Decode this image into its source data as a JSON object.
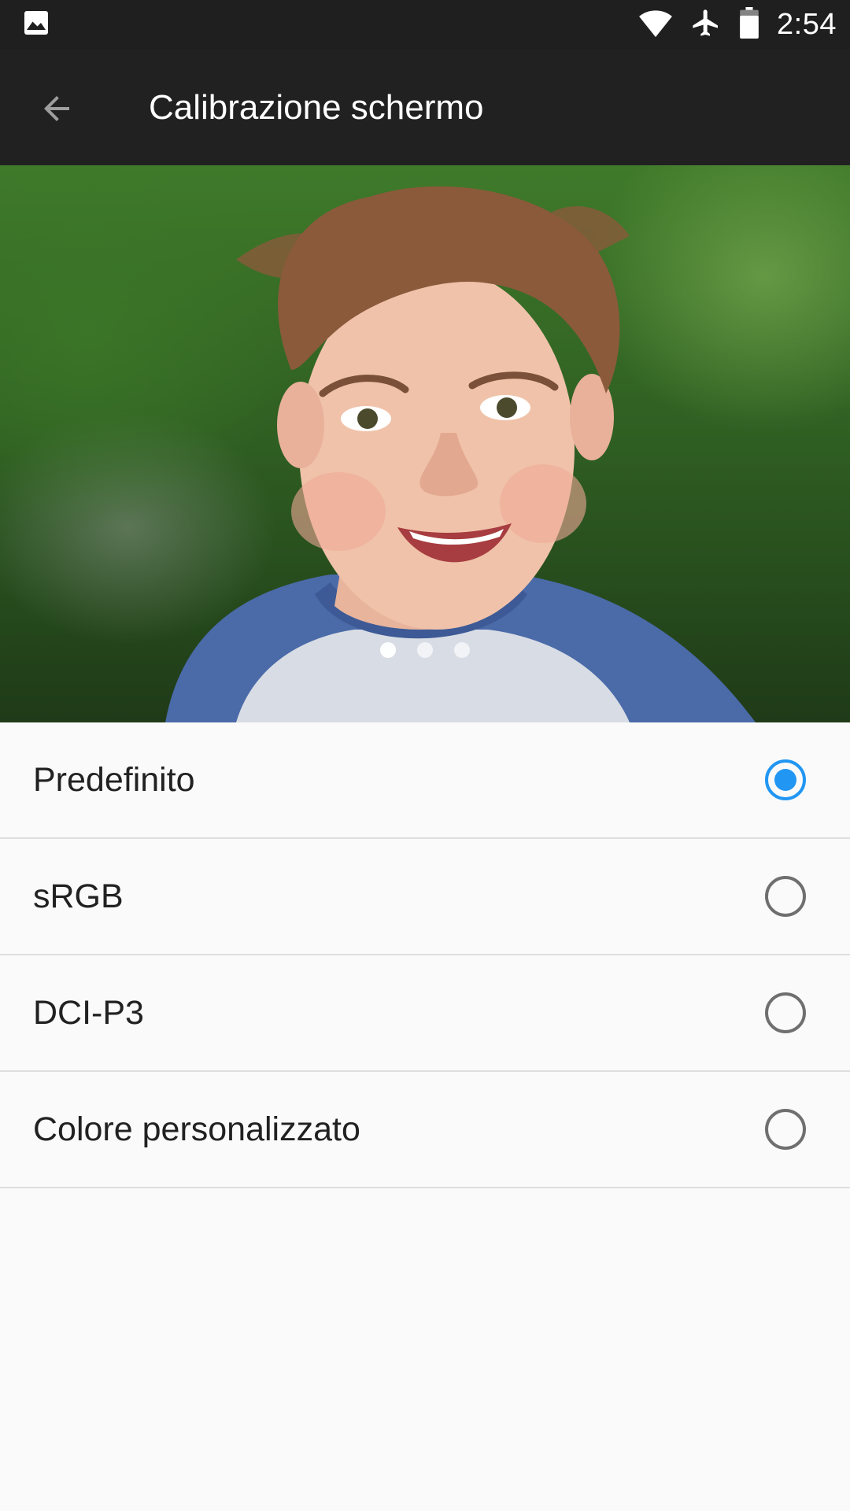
{
  "status_bar": {
    "time": "2:54",
    "icons": [
      "image-notification-icon",
      "wifi-icon",
      "airplane-mode-icon",
      "battery-icon"
    ]
  },
  "app_bar": {
    "back_icon": "arrow-back-icon",
    "title": "Calibrazione schermo"
  },
  "preview": {
    "pages": 3,
    "active_page": 1
  },
  "options": [
    {
      "label": "Predefinito",
      "selected": true
    },
    {
      "label": "sRGB",
      "selected": false
    },
    {
      "label": "DCI-P3",
      "selected": false
    },
    {
      "label": "Colore personalizzato",
      "selected": false
    }
  ],
  "colors": {
    "accent": "#2196f3",
    "toolbar": "#212121",
    "status_bar": "#1f1f1f",
    "background": "#fafafa"
  }
}
